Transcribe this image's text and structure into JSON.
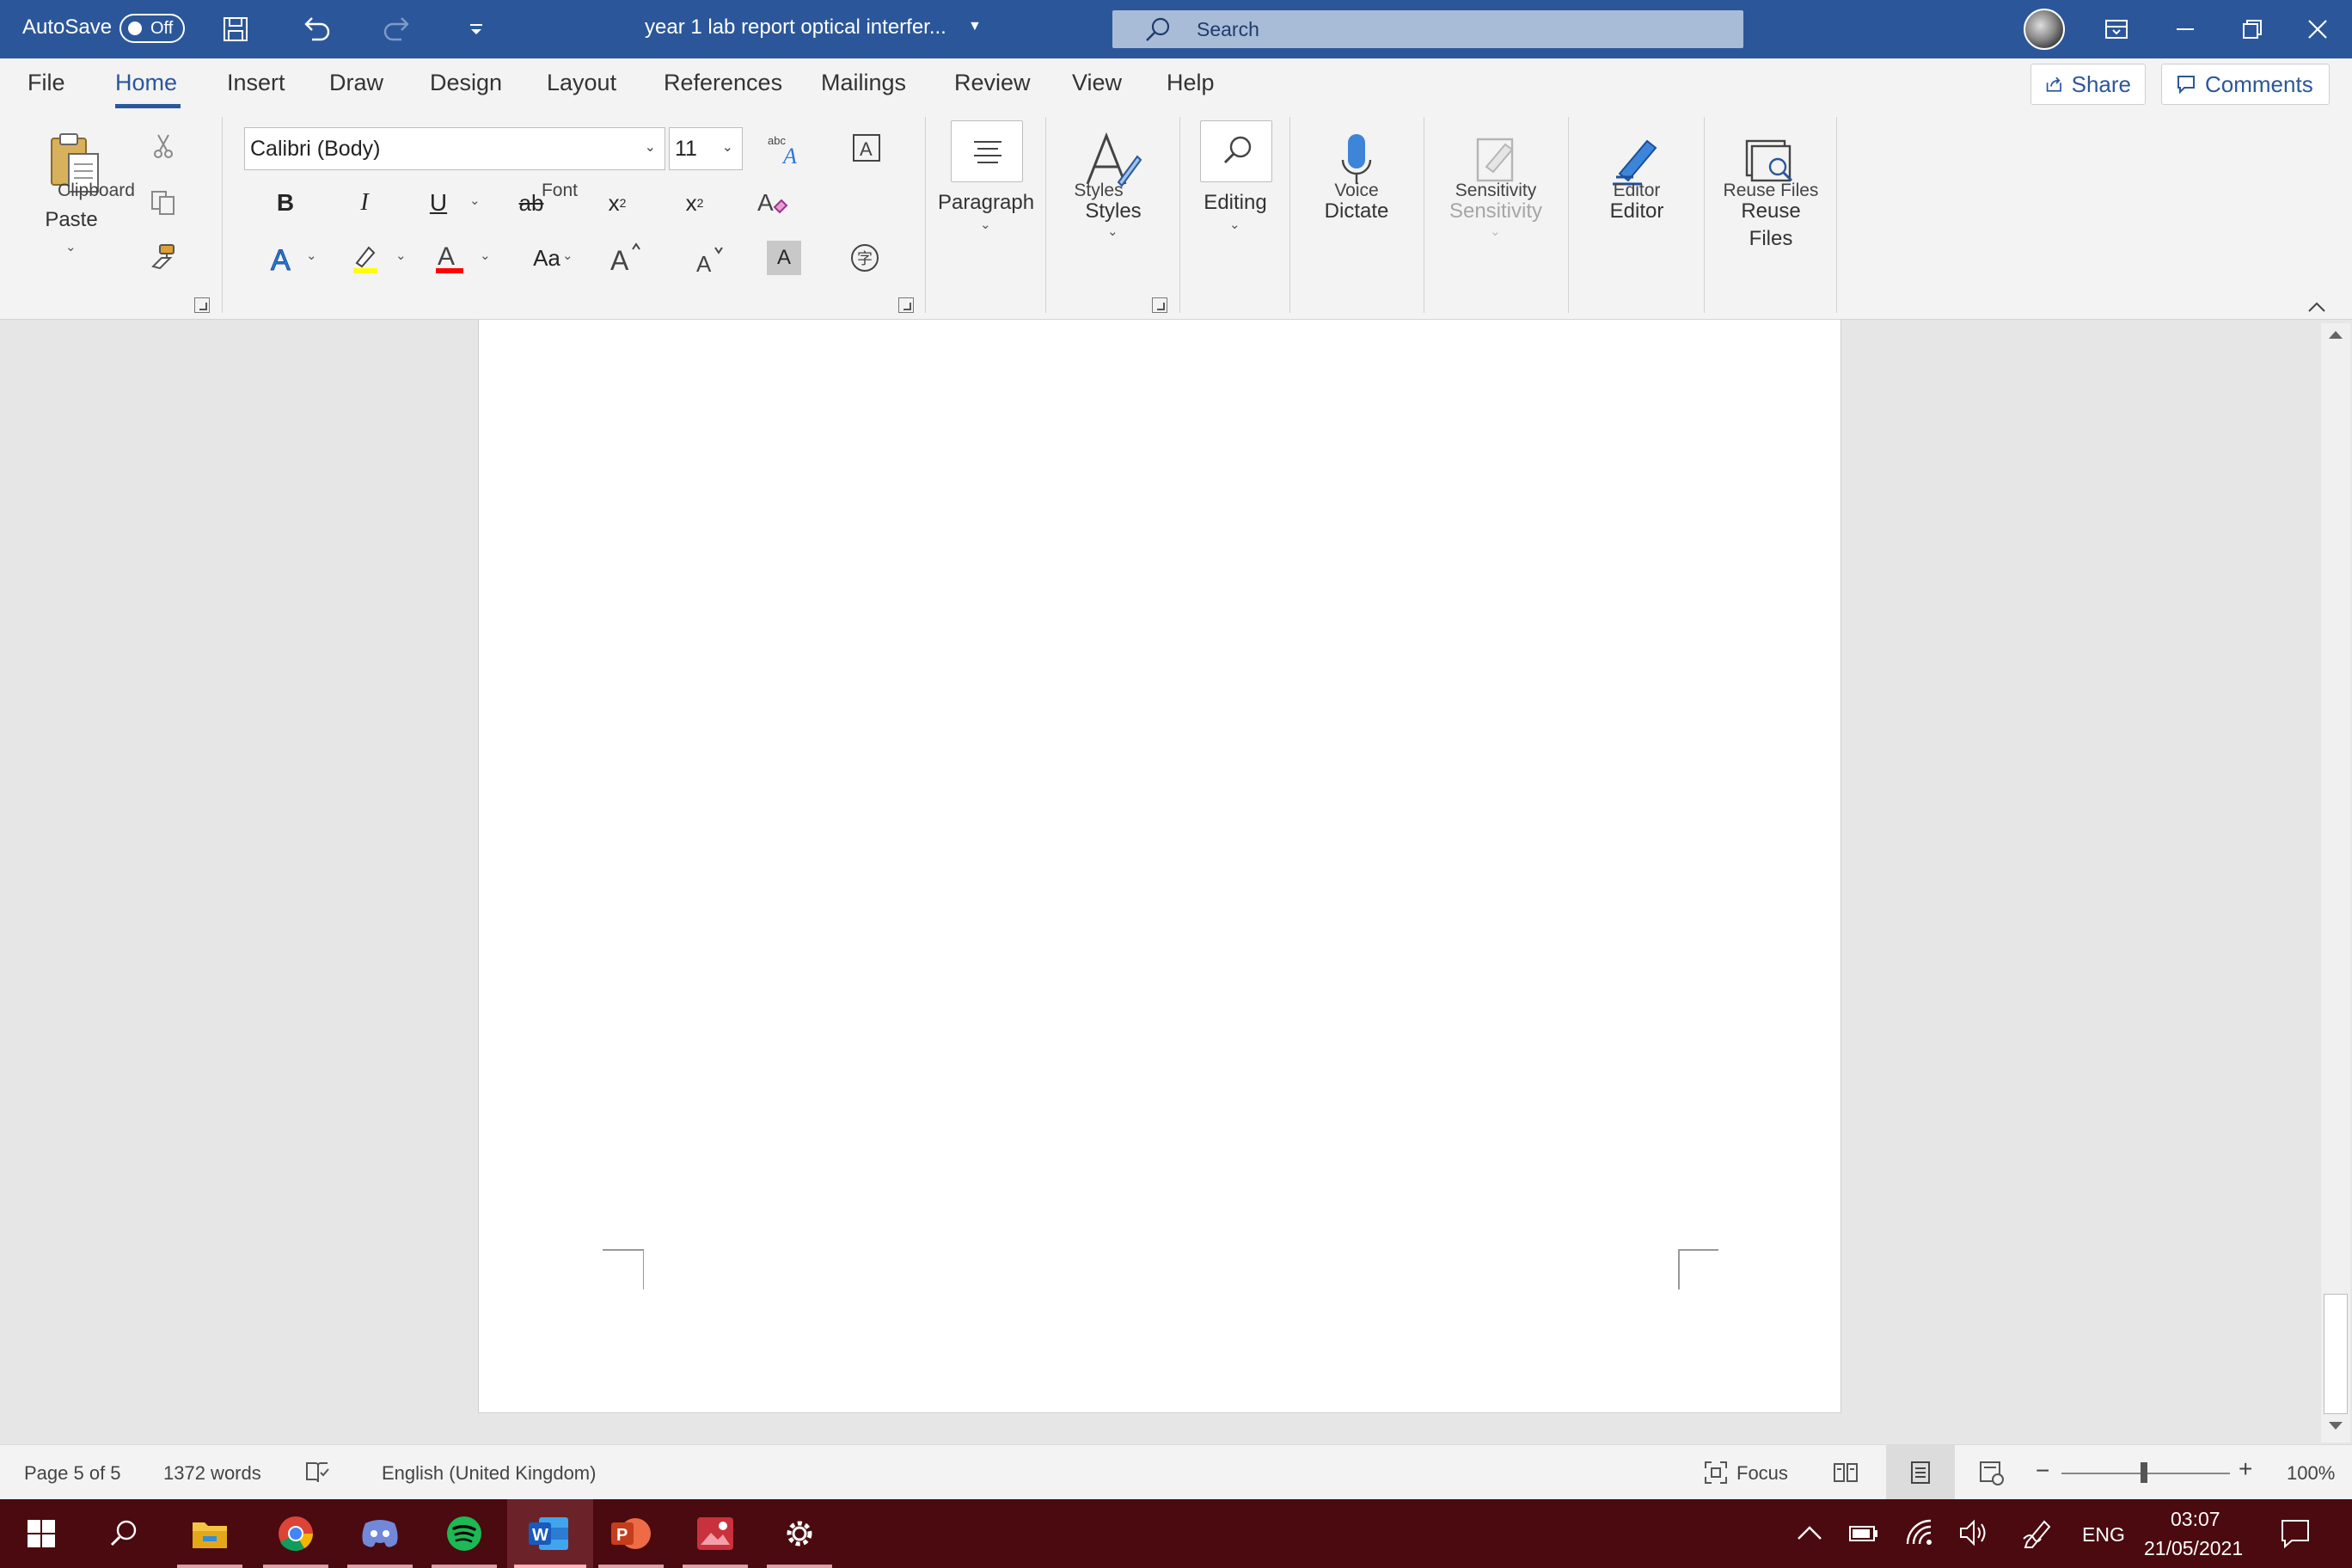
{
  "titlebar": {
    "autosave_label": "AutoSave",
    "autosave_state": "Off",
    "document_title": "year 1 lab report optical interfer...",
    "search_placeholder": "Search",
    "icons": [
      "save-icon",
      "undo-icon",
      "redo-icon",
      "customize-toolbar-icon",
      "ribbon-display-icon",
      "minimize-icon",
      "restore-icon",
      "close-icon"
    ]
  },
  "tabs": [
    "File",
    "Home",
    "Insert",
    "Draw",
    "Design",
    "Layout",
    "References",
    "Mailings",
    "Review",
    "View",
    "Help"
  ],
  "active_tab": "Home",
  "share_label": "Share",
  "comments_label": "Comments",
  "ribbon": {
    "clipboard": {
      "label": "Clipboard",
      "paste_label": "Paste"
    },
    "font": {
      "label": "Font",
      "font_name": "Calibri (Body)",
      "font_size": "11"
    },
    "paragraph": {
      "label": "Paragraph"
    },
    "styles": {
      "label": "Styles",
      "button_label": "Styles"
    },
    "editing": {
      "label": "Editing"
    },
    "voice": {
      "label": "Voice",
      "button_label": "Dictate"
    },
    "sensitivity": {
      "label": "Sensitivity",
      "button_label": "Sensitivity"
    },
    "editor": {
      "label": "Editor",
      "button_label": "Editor"
    },
    "reuse": {
      "label": "Reuse Files",
      "button_line1": "Reuse",
      "button_line2": "Files"
    }
  },
  "statusbar": {
    "page": "Page 5 of 5",
    "words": "1372 words",
    "language": "English (United Kingdom)",
    "focus": "Focus",
    "zoom": "100%",
    "zoom_level_percent": 100
  },
  "taskbar": {
    "apps": [
      "start-icon",
      "search-icon",
      "file-explorer-icon",
      "chrome-icon",
      "discord-icon",
      "spotify-icon",
      "word-icon",
      "powerpoint-icon",
      "photos-icon",
      "settings-icon"
    ],
    "language": "ENG",
    "time": "03:07",
    "date": "21/05/2021"
  },
  "colors": {
    "accent": "#2b579a",
    "taskbar": "#4a0a0f",
    "highlight": "#ffff00",
    "font_color": "#ff0000"
  }
}
